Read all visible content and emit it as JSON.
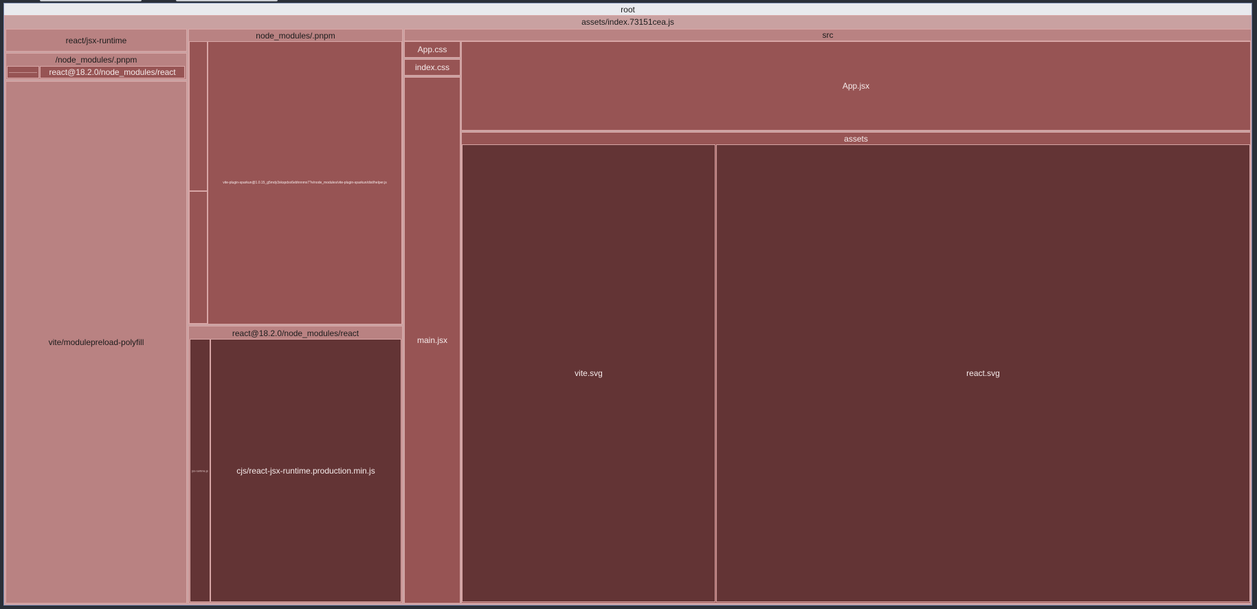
{
  "treemap": {
    "root": "root",
    "bundle": "assets/index.73151cea.js",
    "jsx_runtime": "react/jsx-runtime",
    "pnpm_left": "/node_modules/.pnpm",
    "react_left": "react@18.2.0/node_modules/react",
    "modulepreload": "vite/modulepreload-polyfill",
    "pnpm_mid": "node_modules/.pnpm",
    "helper": "vite-plugin-sparkun@1.0.15_g5mdy3xkspdxx6ebhnnmx7?e/node_modules/vite-plugin-sparkun/dist/helper.js",
    "react_mid": "react@18.2.0/node_modules/react",
    "jsx_runtime_small": "jsx-runtime.js",
    "jsx_runtime_prod": "cjs/react-jsx-runtime.production.min.js",
    "app_css": "App.css",
    "index_css": "index.css",
    "main_jsx": "main.jsx",
    "src": "src",
    "app_jsx": "App.jsx",
    "assets": "assets",
    "vite_svg": "vite.svg",
    "react_svg": "react.svg"
  },
  "colors": {
    "root": "#e9eaee",
    "level1": "#c9a1a1",
    "level2": "#b98282",
    "level3": "#975454",
    "level4": "#633435",
    "border": "#d8a6a6"
  }
}
